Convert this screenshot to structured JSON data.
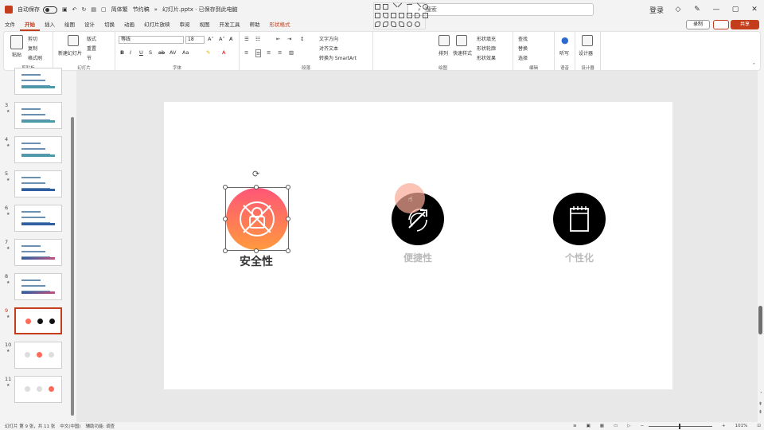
{
  "titlebar": {
    "autosave_label": "自动保存",
    "autosave_state": "关",
    "mode": "简体繁",
    "mode2": "节约稿",
    "file_title": "幻灯片.pptx · 已保存到此电脑",
    "search_placeholder": "搜索",
    "user": "登录"
  },
  "menu": {
    "tabs": [
      "文件",
      "开始",
      "插入",
      "绘图",
      "设计",
      "切换",
      "动画",
      "幻灯片放映",
      "审阅",
      "视图",
      "开发工具",
      "帮助",
      "形状格式"
    ],
    "active_index": 1,
    "context_index": 12
  },
  "actions": {
    "record": "录制",
    "share": "共享"
  },
  "ribbon": {
    "clipboard": {
      "label": "剪贴板",
      "paste": "粘贴",
      "cut": "剪切",
      "copy": "复制",
      "format_painter": "格式刷"
    },
    "slides": {
      "label": "幻灯片",
      "new_slide": "新建幻灯片",
      "layout": "版式",
      "reset": "重置",
      "section": "节"
    },
    "font": {
      "label": "字体",
      "font_name": "等线",
      "font_size": "18"
    },
    "paragraph": {
      "label": "段落",
      "text_direction": "文字方向",
      "align_text": "对齐文本",
      "smartart": "转换为 SmartArt"
    },
    "drawing": {
      "label": "绘图",
      "arrange": "排列",
      "quick_styles": "快速样式",
      "fill": "形状填充",
      "outline": "形状轮廓",
      "effects": "形状效果"
    },
    "editing": {
      "label": "编辑",
      "find": "查找",
      "replace": "替换",
      "select": "选择"
    },
    "voice": {
      "label": "语音",
      "dictate": "听写"
    },
    "designer": {
      "label": "设计器",
      "designer": "设计器"
    }
  },
  "slides_panel": {
    "thumbnails": [
      {
        "num": "",
        "kind": "table"
      },
      {
        "num": "3",
        "kind": "table"
      },
      {
        "num": "4",
        "kind": "table"
      },
      {
        "num": "5",
        "kind": "table-blue"
      },
      {
        "num": "6",
        "kind": "table-blue"
      },
      {
        "num": "7",
        "kind": "table-mixed"
      },
      {
        "num": "8",
        "kind": "table-mixed"
      },
      {
        "num": "9",
        "kind": "dots-first"
      },
      {
        "num": "10",
        "kind": "dots-middle"
      },
      {
        "num": "11",
        "kind": "dots-last"
      }
    ],
    "active_num": "9"
  },
  "slide": {
    "features": [
      {
        "label": "安全性",
        "icon": "lock-icon",
        "selected": true
      },
      {
        "label": "便捷性",
        "icon": "cursor-click-icon",
        "selected": false
      },
      {
        "label": "个性化",
        "icon": "notepad-icon",
        "selected": false
      }
    ],
    "gradient_colors": [
      "#ff5577",
      "#ff9a3d"
    ]
  },
  "statusbar": {
    "slide_position": "幻灯片 第 9 张，共 11 张",
    "language": "中文(中国)",
    "accessibility": "辅助功能: 调查",
    "zoom": "101%"
  }
}
